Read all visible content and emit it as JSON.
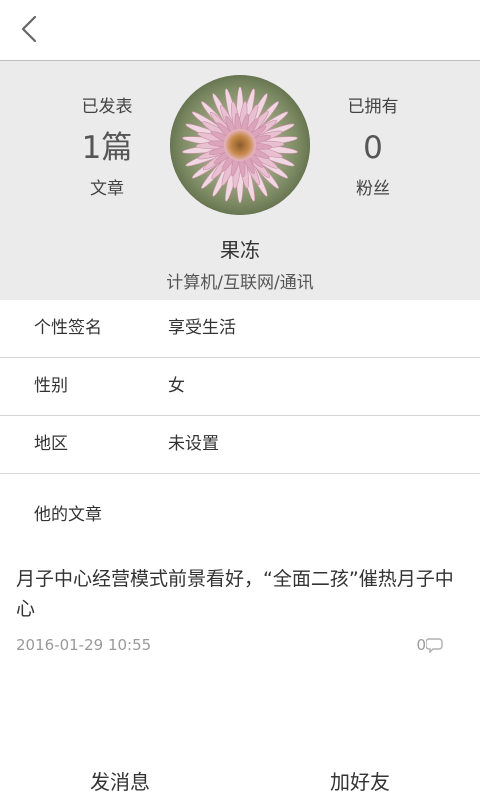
{
  "header": {
    "back_icon": "chevron-left-icon"
  },
  "profile": {
    "published_label_top": "已发表",
    "published_count": "1篇",
    "published_label_bottom": "文章",
    "followers_label_top": "已拥有",
    "followers_count": "0",
    "followers_label_bottom": "粉丝",
    "nickname": "果冻",
    "industry": "计算机/互联网/通讯",
    "colors": {
      "background": "#ebebeb"
    }
  },
  "info": [
    {
      "key": "个性签名",
      "value": "享受生活"
    },
    {
      "key": "性别",
      "value": "女"
    },
    {
      "key": "地区",
      "value": "未设置"
    }
  ],
  "articles_section": {
    "title": "他的文章",
    "items": [
      {
        "title": "月子中心经营模式前景看好，“全面二孩”催热月子中心",
        "date": "2016-01-29 10:55",
        "comment_count": "0",
        "comment_icon": "comment-bubble-icon"
      }
    ]
  },
  "actions": {
    "send_message": "发消息",
    "add_friend": "加好友"
  }
}
